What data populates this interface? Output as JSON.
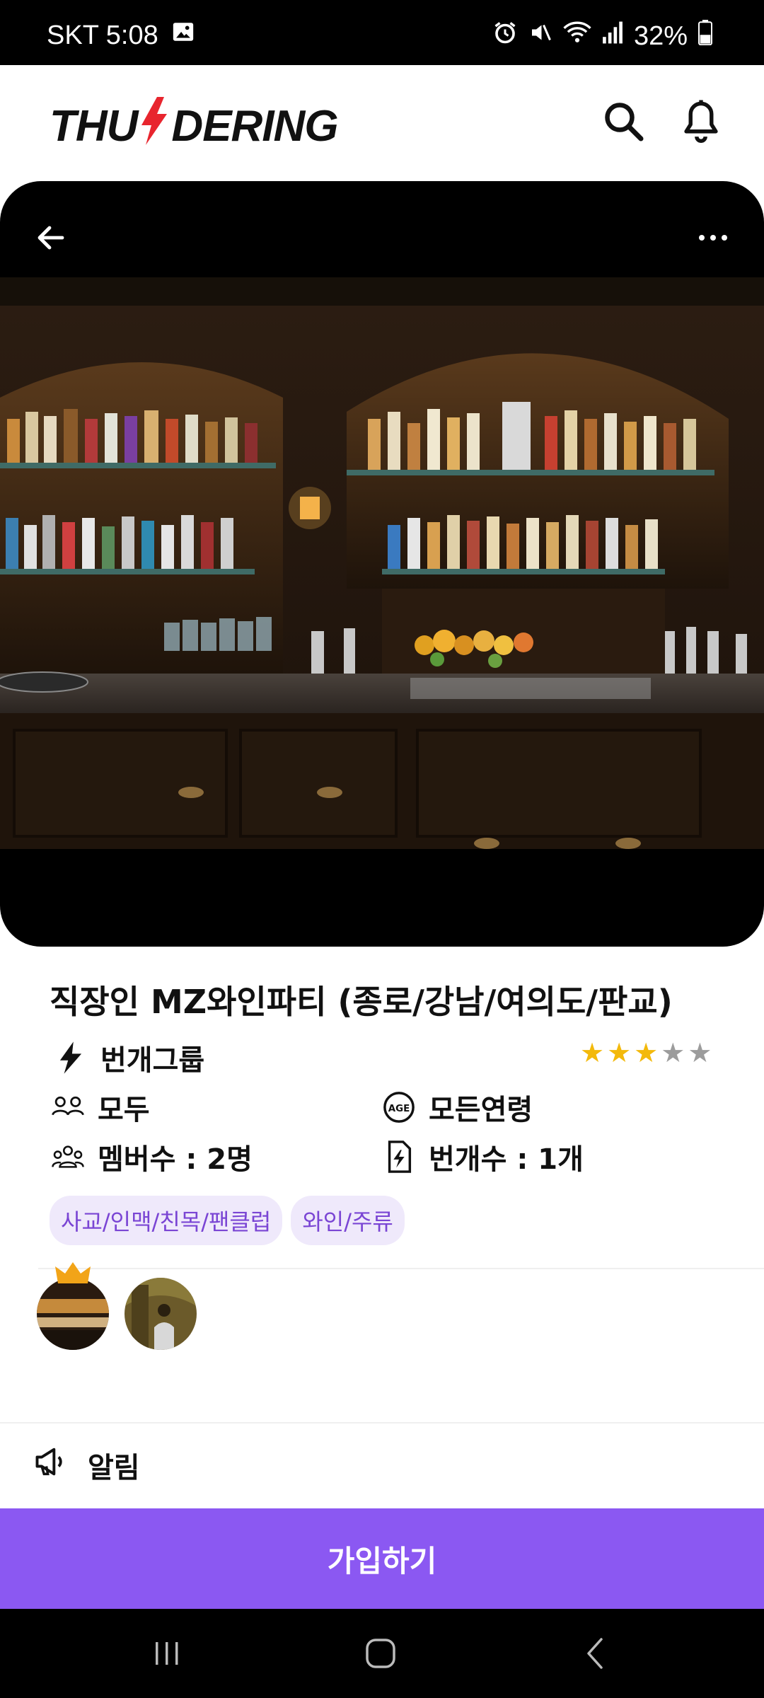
{
  "status_bar": {
    "carrier_time": "SKT 5:08",
    "battery": "32%"
  },
  "header": {
    "logo_left": "THU",
    "logo_right": "DERING",
    "search_icon": "search-icon",
    "bell_icon": "bell-icon"
  },
  "hero": {
    "back_icon": "arrow-left-icon",
    "more_icon": "more-horizontal-icon"
  },
  "group": {
    "title": "직장인 MZ와인파티 (종로/강남/여의도/판교)",
    "type_label": "번개그룹",
    "rating": 3,
    "rating_max": 5,
    "gender": "모두",
    "age": "모든연령",
    "members": "멤버수 : 2명",
    "events": "번개수 : 1개",
    "age_badge": "AGE",
    "tags": [
      "사교/인맥/친목/팬클럽",
      "와인/주류"
    ]
  },
  "notice": {
    "label": "알림"
  },
  "join_button": {
    "label": "가입하기"
  },
  "colors": {
    "accent": "#8b58f2",
    "tag_bg": "#efe9fb",
    "tag_text": "#7a45d4",
    "star": "#f3b90b",
    "logo_bolt": "#e8252e"
  }
}
